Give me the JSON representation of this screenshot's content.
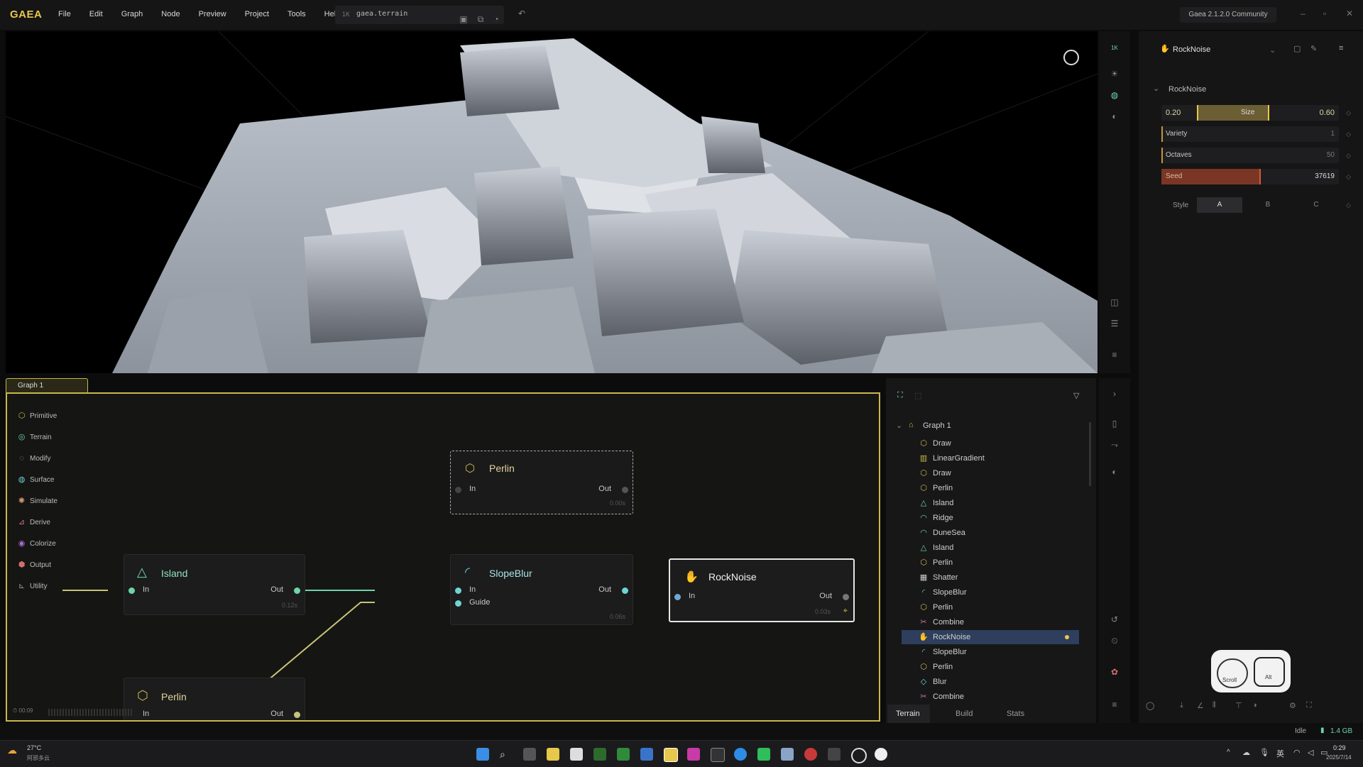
{
  "app": {
    "logo": "GAEA",
    "menu": [
      "File",
      "Edit",
      "Graph",
      "Node",
      "Preview",
      "Project",
      "Tools",
      "Help"
    ],
    "file_prefix": "1K",
    "file_name": "gaea.terrain",
    "version": "Gaea 2.1.2.0 Community"
  },
  "viewport_right": {
    "top_label": "1K"
  },
  "properties": {
    "node_name": "RockNoise",
    "section": "RockNoise",
    "size": {
      "label": "Size",
      "min": "0.20",
      "max": "0.60",
      "range_fraction": [
        0.2,
        0.6
      ]
    },
    "variety": {
      "label": "Variety",
      "value": "1"
    },
    "octaves": {
      "label": "Octaves",
      "value": "50"
    },
    "seed": {
      "label": "Seed",
      "value": "37619",
      "fill_fraction": 0.55
    },
    "style": {
      "label": "Style",
      "options": [
        "A",
        "B",
        "C"
      ],
      "selected": "A"
    }
  },
  "graph": {
    "tab": "Graph 1",
    "categories": [
      "Primitive",
      "Terrain",
      "Modify",
      "Surface",
      "Simulate",
      "Derive",
      "Colorize",
      "Output",
      "Utility"
    ],
    "nodes": {
      "perlin_top": {
        "title": "Perlin",
        "in": "In",
        "out": "Out",
        "time": "0.00s"
      },
      "island": {
        "title": "Island",
        "in": "In",
        "out": "Out",
        "time": "0.12s"
      },
      "slopeblur": {
        "title": "SlopeBlur",
        "in": "In",
        "guide": "Guide",
        "out": "Out",
        "time": "0.06s"
      },
      "rocknoise": {
        "title": "RockNoise",
        "in": "In",
        "out": "Out",
        "time": "0.03s"
      },
      "perlin_bottom": {
        "title": "Perlin",
        "in": "In",
        "out": "Out"
      }
    },
    "timer": "00:09"
  },
  "tree": {
    "root": "Graph 1",
    "items": [
      "Draw",
      "LinearGradient",
      "Draw",
      "Perlin",
      "Island",
      "Ridge",
      "DuneSea",
      "Island",
      "Perlin",
      "Shatter",
      "SlopeBlur",
      "Perlin",
      "Combine",
      "RockNoise",
      "SlopeBlur",
      "Perlin",
      "Blur",
      "Combine"
    ],
    "selected_index": 13,
    "tabs": [
      "Terrain",
      "Build",
      "Stats"
    ]
  },
  "status": {
    "state": "Idle",
    "memory": "1.4 GB"
  },
  "mouse_hint": {
    "left": "Scroll",
    "right": "Alt"
  },
  "taskbar": {
    "weather": "27°C",
    "weather_desc": "阿邪多云",
    "time": "0:29",
    "date": "2025/7/14"
  },
  "colors": {
    "accent": "#e8c84a",
    "node_accent": "#6fd4a8",
    "seed_bar": "#d4583a",
    "selected_row": "#2e3e5c"
  }
}
